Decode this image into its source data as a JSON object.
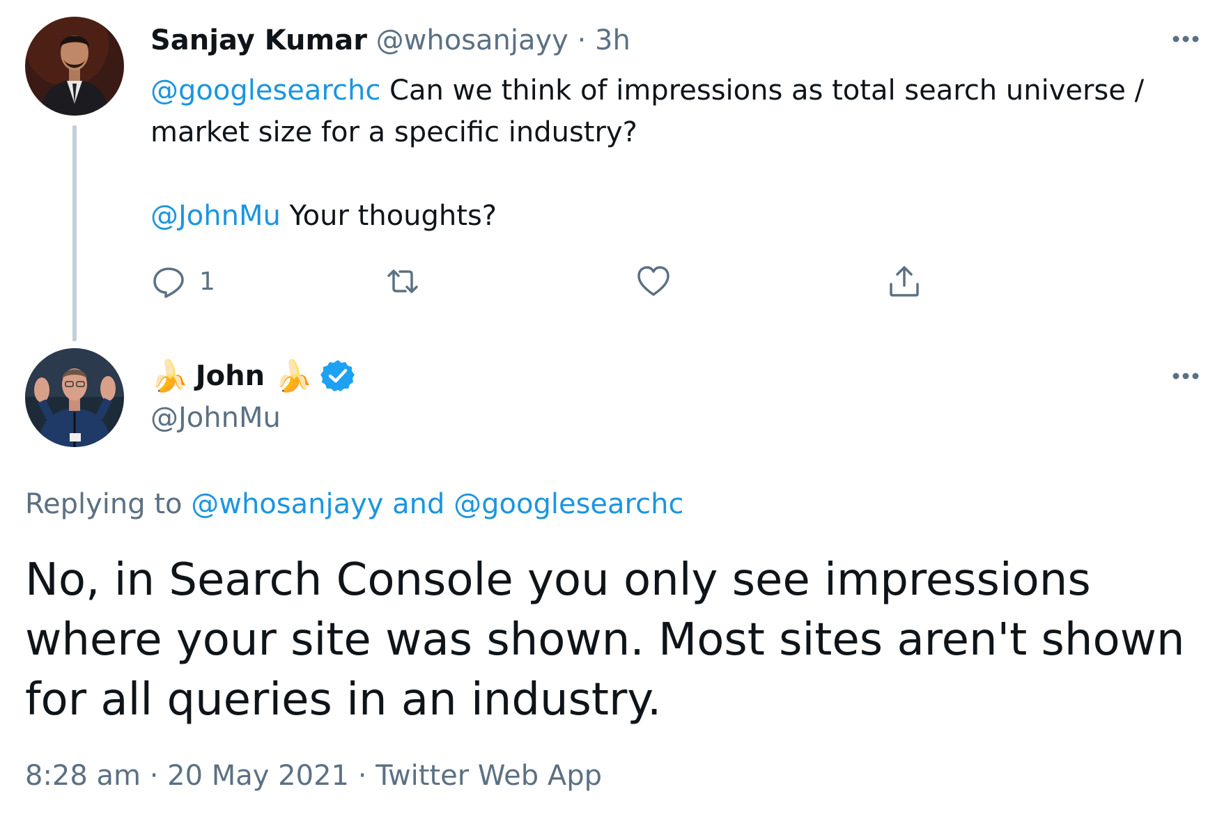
{
  "colors": {
    "link": "#1b95e0",
    "muted": "#5b7083",
    "text": "#0f1419",
    "thread_line": "#c4cfd6",
    "verified": "#1da1f2"
  },
  "parent_tweet": {
    "author_name": "Sanjay Kumar",
    "handle": "@whosanjayy",
    "separator": "·",
    "time_ago": "3h",
    "mention_1": "@googlesearchc",
    "text_1": " Can we think of impressions as total search universe / market size for a specific industry?",
    "mention_2": "@JohnMu",
    "text_2": " Your thoughts?",
    "actions": {
      "reply_icon": "reply-icon",
      "reply_count": "1",
      "retweet_icon": "retweet-icon",
      "like_icon": "heart-icon",
      "share_icon": "share-icon"
    },
    "more_icon": "more-icon"
  },
  "reply_tweet": {
    "emoji_left": "🍌",
    "author_name": "John",
    "emoji_right": "🍌",
    "verified_icon": "verified-badge-icon",
    "handle": "@JohnMu",
    "replying_prefix": "Replying to ",
    "replying_user_1": "@whosanjayy",
    "replying_and": " and ",
    "replying_user_2": "@googlesearchc",
    "text": "No, in Search Console you only see impressions where your site was shown. Most sites aren't shown for all queries in an industry.",
    "timestamp": "8:28 am · 20 May 2021 · Twitter Web App",
    "more_icon": "more-icon"
  }
}
